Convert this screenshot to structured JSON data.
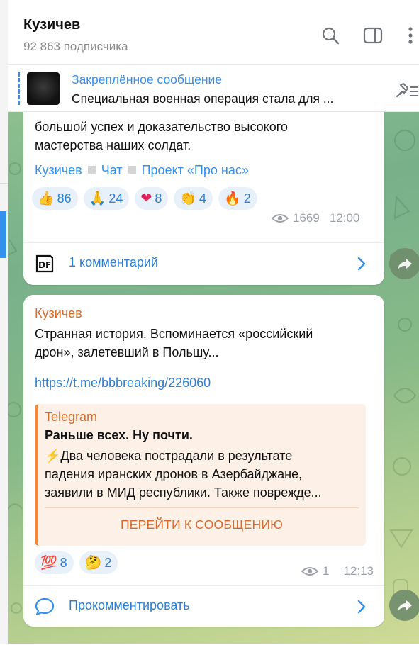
{
  "channel": {
    "title": "Кузичев",
    "subscribers": "92 863 подписчика"
  },
  "header_icons": [
    "search-icon",
    "sidebar-toggle-icon",
    "more-vertical-icon"
  ],
  "pinned": {
    "title": "Закреплённое сообщение",
    "text": "Специальная военная операция стала для ..."
  },
  "post1": {
    "text_line1": "большой успех и доказательство высокого",
    "text_line2": "мастерства наших солдат.",
    "tags": [
      "Кузичев",
      "Чат",
      "Проект «Про нас»"
    ],
    "reactions": [
      {
        "emoji": "👍",
        "count": "86"
      },
      {
        "emoji": "🙏",
        "count": "24"
      },
      {
        "emoji": "❤",
        "count": "8"
      },
      {
        "emoji": "👏",
        "count": "4"
      },
      {
        "emoji": "🔥",
        "count": "2"
      }
    ],
    "views": "1669",
    "time": "12:00",
    "comments_label": "1 комментарий"
  },
  "post2": {
    "author": "Кузичев",
    "text_line1": "Странная история. Вспоминается «российский",
    "text_line2": "дрон», залетевший в Польшу...",
    "link": "https://t.me/bbbreaking/226060",
    "preview": {
      "source": "Telegram",
      "title": "Раньше всех. Ну почти.",
      "line1": "⚡Два человека пострадали в результате",
      "line2": "падения иранских дронов в Азербайджане,",
      "line3": "заявили в МИД республики. Также поврежде...",
      "button": "ПЕРЕЙТИ К СООБЩЕНИЮ"
    },
    "reactions": [
      {
        "emoji": "💯",
        "count": "8"
      },
      {
        "emoji": "🤔",
        "count": "2"
      }
    ],
    "views": "1",
    "time": "12:13",
    "comments_label": "Прокомментировать"
  },
  "colors": {
    "accent": "#3390ec",
    "author": "#d76a2a",
    "preview_bg": "#fdf0e6"
  }
}
